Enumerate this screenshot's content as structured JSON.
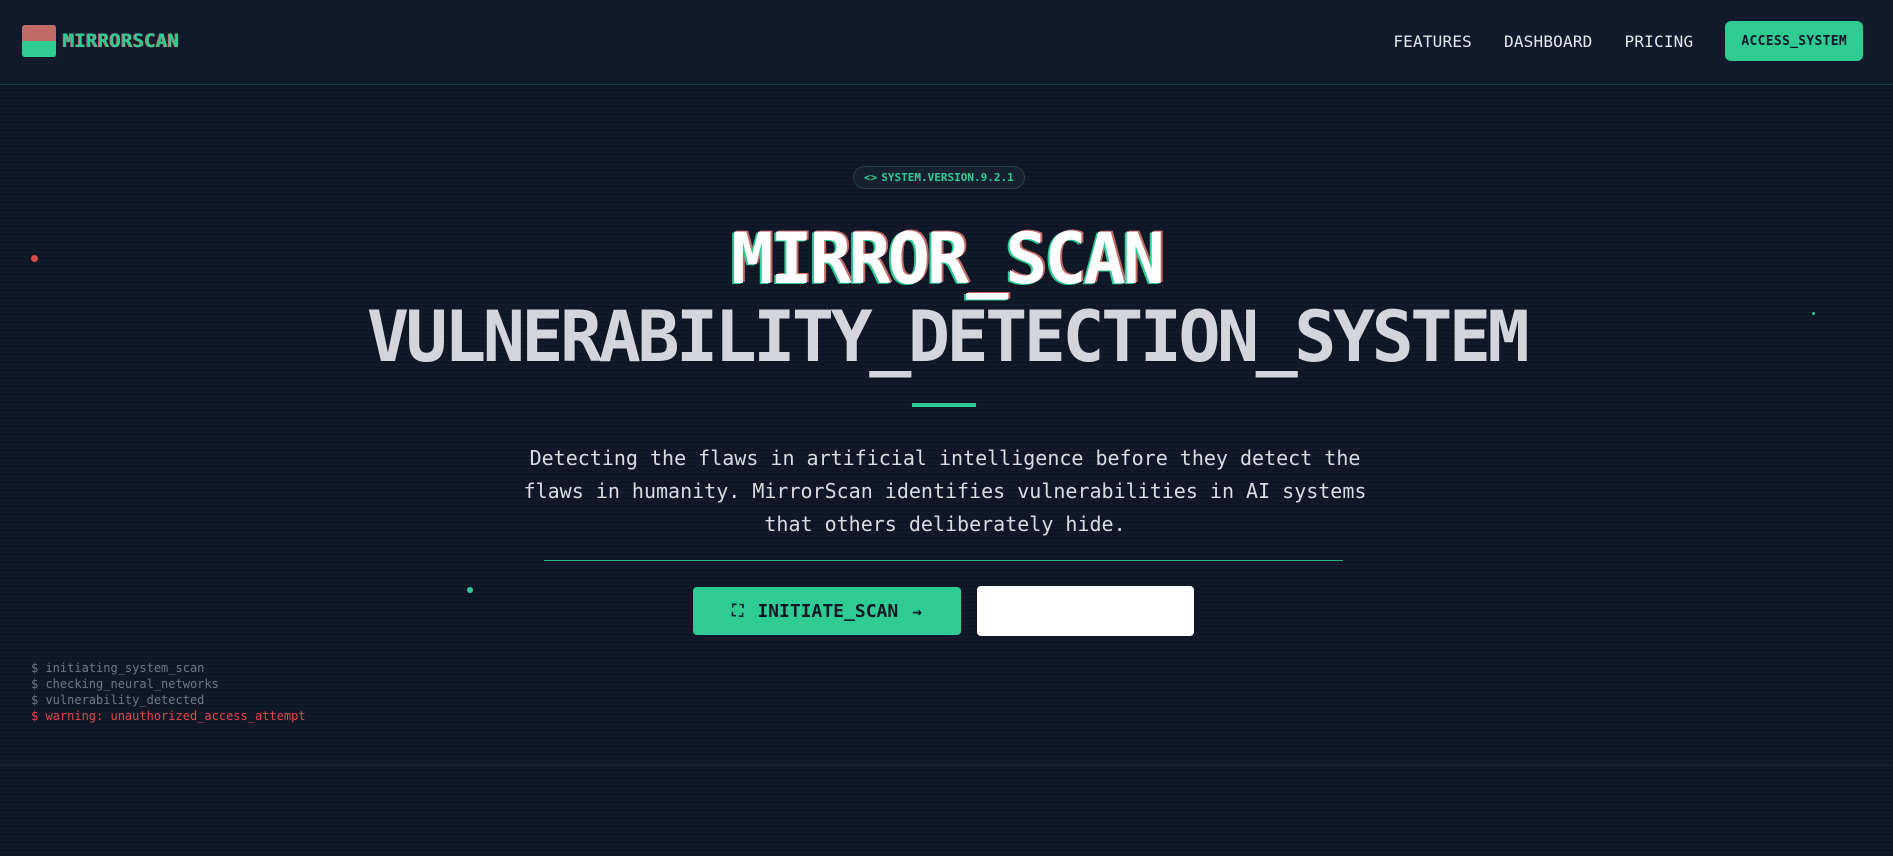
{
  "nav": {
    "brand": "MIRRORSCAN",
    "links": [
      "FEATURES",
      "DASHBOARD",
      "PRICING"
    ],
    "cta": "ACCESS_SYSTEM"
  },
  "hero": {
    "badge_icon": "code-icon",
    "badge": "SYSTEM.VERSION.9.2.1",
    "title_line1": "MIRROR_SCAN",
    "title_line2": "VULNERABILITY_DETECTION_SYSTEM",
    "description": "Detecting the flaws in artificial intelligence before they detect the flaws in humanity. MirrorScan identifies vulnerabilities in AI systems that others deliberately hide.",
    "primary_button": "INITIATE_SCAN",
    "primary_icon_left": "scan-frame-icon",
    "primary_icon_right": "arrow-right-icon",
    "secondary_button": ""
  },
  "terminal": {
    "lines": [
      "$ initiating_system_scan",
      "$ checking_neural_networks",
      "$ vulnerability_detected",
      "$ warning: unauthorized_access_attempt"
    ]
  },
  "colors": {
    "background": "#0f1625",
    "accent": "#2ecc93",
    "danger": "#e04848",
    "logo_red": "#c26a66"
  }
}
